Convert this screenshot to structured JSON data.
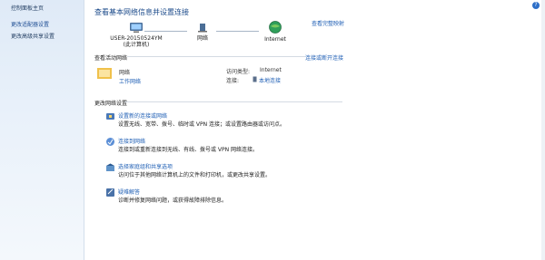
{
  "sidebar": {
    "items": [
      {
        "label": "控制面板主页"
      },
      {
        "label": "更改适配器设置"
      },
      {
        "label": "更改高级共享设置"
      }
    ]
  },
  "main": {
    "title": "查看基本网络信息并设置连接",
    "view_full_map": "查看完整映射",
    "network_map": {
      "computer_name": "USER-20150524YM",
      "computer_sub": "(此计算机)",
      "network_label": "网络",
      "internet_label": "Internet"
    },
    "active_networks": {
      "header": "查看活动网络",
      "connect_disconnect": "连接或断开连接",
      "network_name": "网络",
      "network_type": "工作网络",
      "access_type_label": "访问类型:",
      "access_type_value": "Internet",
      "connections_label": "连接:",
      "connections_value": "本地连接"
    },
    "change_settings": {
      "header": "更改网络设置",
      "tasks": [
        {
          "title": "设置新的连接或网络",
          "desc": "设置无线、宽带、拨号、临时或 VPN 连接；或设置路由器或访问点。"
        },
        {
          "title": "连接到网络",
          "desc": "连接到或重新连接到无线、有线、拨号或 VPN 网络连接。"
        },
        {
          "title": "选择家庭组和共享选项",
          "desc": "访问位于其他网络计算机上的文件和打印机，或更改共享设置。"
        },
        {
          "title": "疑难解答",
          "desc": "诊断并修复网络问题，或获得故障排除信息。"
        }
      ]
    }
  },
  "colors": {
    "accent": "#1f5fb5",
    "title": "#1b4a8a",
    "sidebar_bg": "#dfeaf7"
  }
}
